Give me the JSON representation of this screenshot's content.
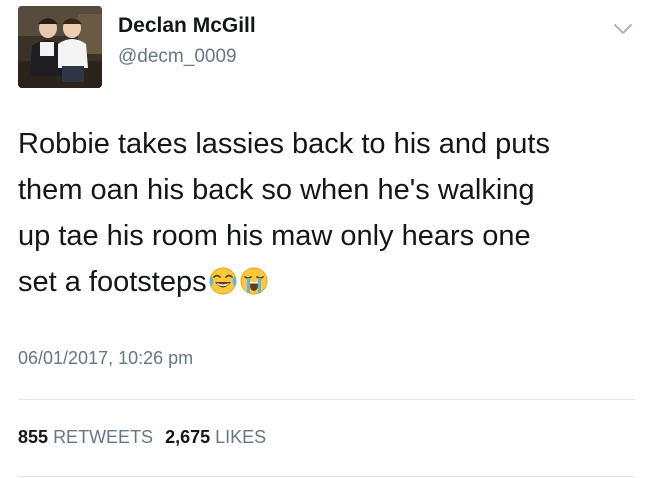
{
  "user": {
    "display_name": "Declan McGill",
    "handle": "@decm_0009",
    "avatar": "profile-photo"
  },
  "tweet": {
    "lines": [
      "Robbie takes lassies back to his and puts",
      "them oan his back so when he's walking",
      "up tae his room his maw only hears one",
      "set a footsteps"
    ],
    "emojis": [
      "face-with-tears-of-joy-icon",
      "loudly-crying-face-icon"
    ],
    "timestamp": "06/01/2017, 10:26 pm"
  },
  "stats": {
    "retweets_count": "855",
    "retweets_label": "RETWEETS",
    "likes_count": "2,675",
    "likes_label": "LIKES"
  },
  "colors": {
    "text": "#14171a",
    "secondary": "#657786",
    "divider": "#e1e8ed"
  }
}
